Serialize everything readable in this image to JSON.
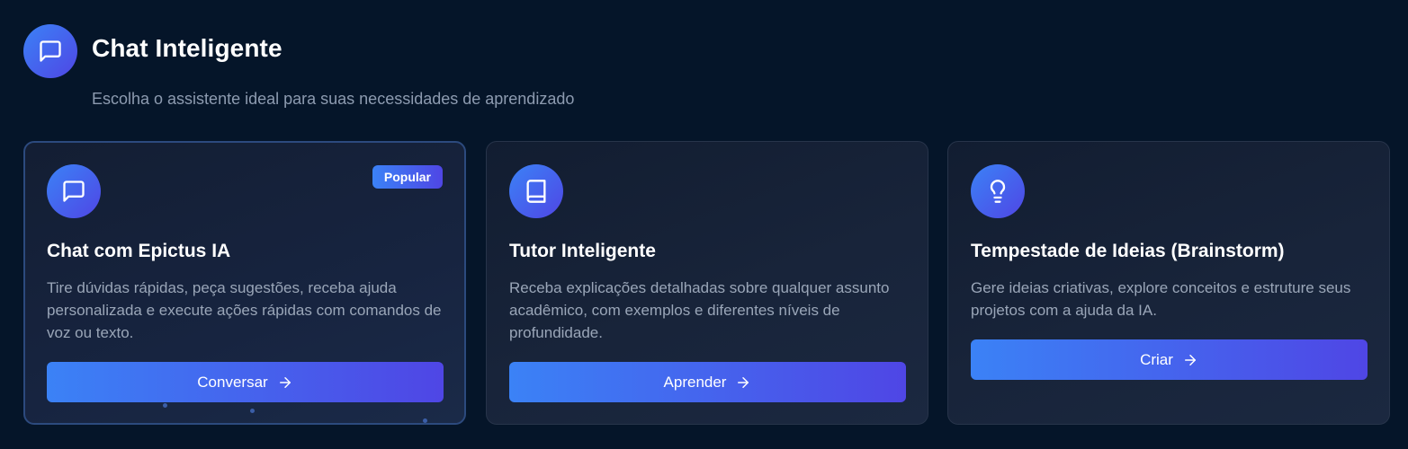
{
  "header": {
    "title": "Chat Inteligente",
    "subtitle": "Escolha o assistente ideal para suas necessidades de aprendizado",
    "icon": "message-square-icon"
  },
  "colors": {
    "background": "#051529",
    "accent_start": "#3b82f6",
    "accent_end": "#4f46e5",
    "text_muted": "#9aa6b8"
  },
  "cards": [
    {
      "icon": "message-square-icon",
      "badge": "Popular",
      "title": "Chat com Epictus IA",
      "description": "Tire dúvidas rápidas, peça sugestões, receba ajuda personalizada e execute ações rápidas com comandos de voz ou texto.",
      "button_label": "Conversar",
      "button_icon": "arrow-right-icon"
    },
    {
      "icon": "book-icon",
      "title": "Tutor Inteligente",
      "description": "Receba explicações detalhadas sobre qualquer assunto acadêmico, com exemplos e diferentes níveis de profundidade.",
      "button_label": "Aprender",
      "button_icon": "arrow-right-icon"
    },
    {
      "icon": "lightbulb-icon",
      "title": "Tempestade de Ideias (Brainstorm)",
      "description": "Gere ideias criativas, explore conceitos e estruture seus projetos com a ajuda da IA.",
      "button_label": "Criar",
      "button_icon": "arrow-right-icon"
    }
  ]
}
